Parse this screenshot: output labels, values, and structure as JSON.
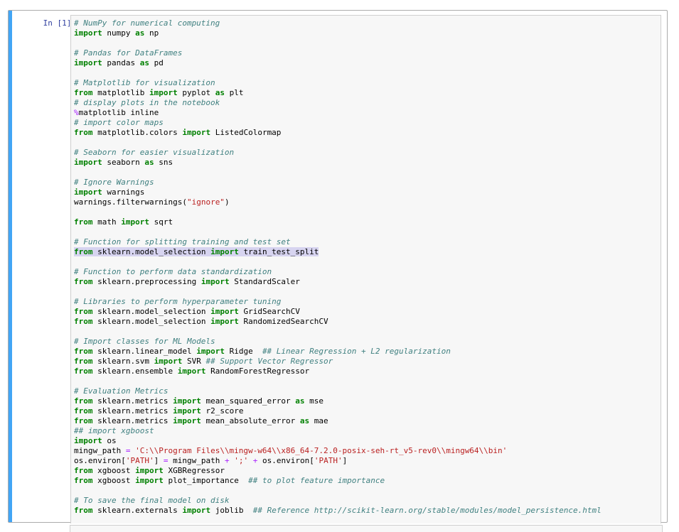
{
  "cell": {
    "prompt": "In [1]:",
    "lines": [
      {
        "tokens": [
          {
            "t": "cm",
            "v": "# NumPy for numerical computing"
          }
        ]
      },
      {
        "tokens": [
          {
            "t": "kw",
            "v": "import"
          },
          {
            "t": "tx",
            "v": " numpy "
          },
          {
            "t": "kw",
            "v": "as"
          },
          {
            "t": "tx",
            "v": " np"
          }
        ]
      },
      {
        "tokens": []
      },
      {
        "tokens": [
          {
            "t": "cm",
            "v": "# Pandas for DataFrames"
          }
        ]
      },
      {
        "tokens": [
          {
            "t": "kw",
            "v": "import"
          },
          {
            "t": "tx",
            "v": " pandas "
          },
          {
            "t": "kw",
            "v": "as"
          },
          {
            "t": "tx",
            "v": " pd"
          }
        ]
      },
      {
        "tokens": []
      },
      {
        "tokens": [
          {
            "t": "cm",
            "v": "# Matplotlib for visualization"
          }
        ]
      },
      {
        "tokens": [
          {
            "t": "kw",
            "v": "from"
          },
          {
            "t": "tx",
            "v": " matplotlib "
          },
          {
            "t": "kw",
            "v": "import"
          },
          {
            "t": "tx",
            "v": " pyplot "
          },
          {
            "t": "kw",
            "v": "as"
          },
          {
            "t": "tx",
            "v": " plt"
          }
        ]
      },
      {
        "tokens": [
          {
            "t": "cm",
            "v": "# display plots in the notebook"
          }
        ]
      },
      {
        "tokens": [
          {
            "t": "magic",
            "v": "%"
          },
          {
            "t": "tx",
            "v": "matplotlib inline"
          }
        ]
      },
      {
        "tokens": [
          {
            "t": "cm",
            "v": "# import color maps"
          }
        ]
      },
      {
        "tokens": [
          {
            "t": "kw",
            "v": "from"
          },
          {
            "t": "tx",
            "v": " matplotlib.colors "
          },
          {
            "t": "kw",
            "v": "import"
          },
          {
            "t": "tx",
            "v": " ListedColormap"
          }
        ]
      },
      {
        "tokens": []
      },
      {
        "tokens": [
          {
            "t": "cm",
            "v": "# Seaborn for easier visualization"
          }
        ]
      },
      {
        "tokens": [
          {
            "t": "kw",
            "v": "import"
          },
          {
            "t": "tx",
            "v": " seaborn "
          },
          {
            "t": "kw",
            "v": "as"
          },
          {
            "t": "tx",
            "v": " sns"
          }
        ]
      },
      {
        "tokens": []
      },
      {
        "tokens": [
          {
            "t": "cm",
            "v": "# Ignore Warnings"
          }
        ]
      },
      {
        "tokens": [
          {
            "t": "kw",
            "v": "import"
          },
          {
            "t": "tx",
            "v": " warnings"
          }
        ]
      },
      {
        "tokens": [
          {
            "t": "tx",
            "v": "warnings.filterwarnings("
          },
          {
            "t": "str",
            "v": "\"ignore\""
          },
          {
            "t": "tx",
            "v": ")"
          }
        ]
      },
      {
        "tokens": []
      },
      {
        "tokens": [
          {
            "t": "kw",
            "v": "from"
          },
          {
            "t": "tx",
            "v": " math "
          },
          {
            "t": "kw",
            "v": "import"
          },
          {
            "t": "tx",
            "v": " sqrt"
          }
        ]
      },
      {
        "tokens": []
      },
      {
        "tokens": [
          {
            "t": "cm",
            "v": "# Function for splitting training and test set"
          }
        ]
      },
      {
        "highlight": true,
        "tokens": [
          {
            "t": "kw",
            "v": "from"
          },
          {
            "t": "tx",
            "v": " sklearn.model_selection "
          },
          {
            "t": "kw",
            "v": "import"
          },
          {
            "t": "tx",
            "v": " train_test_split"
          }
        ]
      },
      {
        "tokens": []
      },
      {
        "tokens": [
          {
            "t": "cm",
            "v": "# Function to perform data standardization"
          }
        ]
      },
      {
        "tokens": [
          {
            "t": "kw",
            "v": "from"
          },
          {
            "t": "tx",
            "v": " sklearn.preprocessing "
          },
          {
            "t": "kw",
            "v": "import"
          },
          {
            "t": "tx",
            "v": " StandardScaler"
          }
        ]
      },
      {
        "tokens": []
      },
      {
        "tokens": [
          {
            "t": "cm",
            "v": "# Libraries to perform hyperparameter tuning"
          }
        ]
      },
      {
        "tokens": [
          {
            "t": "kw",
            "v": "from"
          },
          {
            "t": "tx",
            "v": " sklearn.model_selection "
          },
          {
            "t": "kw",
            "v": "import"
          },
          {
            "t": "tx",
            "v": " GridSearchCV"
          }
        ]
      },
      {
        "tokens": [
          {
            "t": "kw",
            "v": "from"
          },
          {
            "t": "tx",
            "v": " sklearn.model_selection "
          },
          {
            "t": "kw",
            "v": "import"
          },
          {
            "t": "tx",
            "v": " RandomizedSearchCV"
          }
        ]
      },
      {
        "tokens": []
      },
      {
        "tokens": [
          {
            "t": "cm",
            "v": "# Import classes for ML Models"
          }
        ]
      },
      {
        "tokens": [
          {
            "t": "kw",
            "v": "from"
          },
          {
            "t": "tx",
            "v": " sklearn.linear_model "
          },
          {
            "t": "kw",
            "v": "import"
          },
          {
            "t": "tx",
            "v": " Ridge  "
          },
          {
            "t": "cm",
            "v": "## Linear Regression + L2 regularization"
          }
        ]
      },
      {
        "tokens": [
          {
            "t": "kw",
            "v": "from"
          },
          {
            "t": "tx",
            "v": " sklearn.svm "
          },
          {
            "t": "kw",
            "v": "import"
          },
          {
            "t": "tx",
            "v": " SVR "
          },
          {
            "t": "cm",
            "v": "## Support Vector Regressor"
          }
        ]
      },
      {
        "tokens": [
          {
            "t": "kw",
            "v": "from"
          },
          {
            "t": "tx",
            "v": " sklearn.ensemble "
          },
          {
            "t": "kw",
            "v": "import"
          },
          {
            "t": "tx",
            "v": " RandomForestRegressor"
          }
        ]
      },
      {
        "tokens": []
      },
      {
        "tokens": [
          {
            "t": "cm",
            "v": "# Evaluation Metrics"
          }
        ]
      },
      {
        "tokens": [
          {
            "t": "kw",
            "v": "from"
          },
          {
            "t": "tx",
            "v": " sklearn.metrics "
          },
          {
            "t": "kw",
            "v": "import"
          },
          {
            "t": "tx",
            "v": " mean_squared_error "
          },
          {
            "t": "kw",
            "v": "as"
          },
          {
            "t": "tx",
            "v": " mse"
          }
        ]
      },
      {
        "tokens": [
          {
            "t": "kw",
            "v": "from"
          },
          {
            "t": "tx",
            "v": " sklearn.metrics "
          },
          {
            "t": "kw",
            "v": "import"
          },
          {
            "t": "tx",
            "v": " r2_score"
          }
        ]
      },
      {
        "tokens": [
          {
            "t": "kw",
            "v": "from"
          },
          {
            "t": "tx",
            "v": " sklearn.metrics "
          },
          {
            "t": "kw",
            "v": "import"
          },
          {
            "t": "tx",
            "v": " mean_absolute_error "
          },
          {
            "t": "kw",
            "v": "as"
          },
          {
            "t": "tx",
            "v": " mae"
          }
        ]
      },
      {
        "tokens": [
          {
            "t": "cm",
            "v": "## import xgboost"
          }
        ]
      },
      {
        "tokens": [
          {
            "t": "kw",
            "v": "import"
          },
          {
            "t": "tx",
            "v": " os"
          }
        ]
      },
      {
        "tokens": [
          {
            "t": "tx",
            "v": "mingw_path "
          },
          {
            "t": "op",
            "v": "="
          },
          {
            "t": "tx",
            "v": " "
          },
          {
            "t": "str",
            "v": "'C:\\\\Program Files\\\\mingw-w64\\\\x86_64-7.2.0-posix-seh-rt_v5-rev0\\\\mingw64\\\\bin'"
          }
        ]
      },
      {
        "tokens": [
          {
            "t": "tx",
            "v": "os.environ["
          },
          {
            "t": "str",
            "v": "'PATH'"
          },
          {
            "t": "tx",
            "v": "] "
          },
          {
            "t": "op",
            "v": "="
          },
          {
            "t": "tx",
            "v": " mingw_path "
          },
          {
            "t": "op",
            "v": "+"
          },
          {
            "t": "tx",
            "v": " "
          },
          {
            "t": "str",
            "v": "';'"
          },
          {
            "t": "tx",
            "v": " "
          },
          {
            "t": "op",
            "v": "+"
          },
          {
            "t": "tx",
            "v": " os.environ["
          },
          {
            "t": "str",
            "v": "'PATH'"
          },
          {
            "t": "tx",
            "v": "]"
          }
        ]
      },
      {
        "tokens": [
          {
            "t": "kw",
            "v": "from"
          },
          {
            "t": "tx",
            "v": " xgboost "
          },
          {
            "t": "kw",
            "v": "import"
          },
          {
            "t": "tx",
            "v": " XGBRegressor"
          }
        ]
      },
      {
        "tokens": [
          {
            "t": "kw",
            "v": "from"
          },
          {
            "t": "tx",
            "v": " xgboost "
          },
          {
            "t": "kw",
            "v": "import"
          },
          {
            "t": "tx",
            "v": " plot_importance  "
          },
          {
            "t": "cm",
            "v": "## to plot feature importance"
          }
        ]
      },
      {
        "tokens": []
      },
      {
        "tokens": [
          {
            "t": "cm",
            "v": "# To save the final model on disk"
          }
        ]
      },
      {
        "tokens": [
          {
            "t": "kw",
            "v": "from"
          },
          {
            "t": "tx",
            "v": " sklearn.externals "
          },
          {
            "t": "kw",
            "v": "import"
          },
          {
            "t": "tx",
            "v": " joblib  "
          },
          {
            "t": "cm",
            "v": "## Reference http://scikit-learn.org/stable/modules/model_persistence.html"
          }
        ]
      }
    ]
  }
}
